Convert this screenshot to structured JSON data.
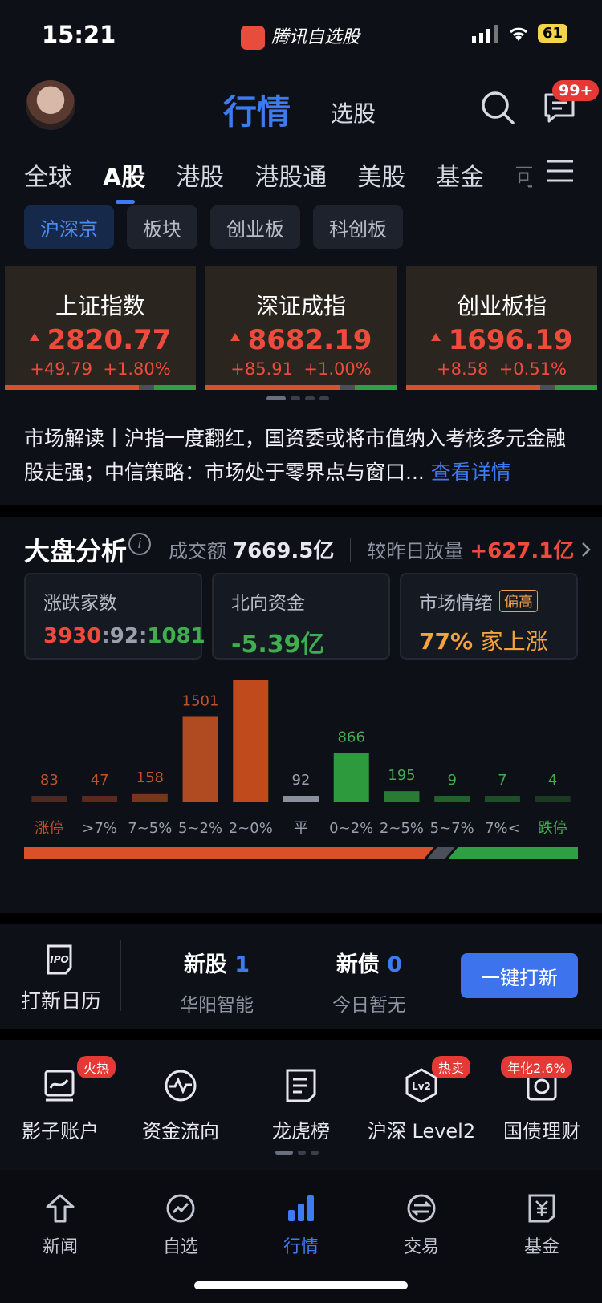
{
  "status": {
    "time": "15:21",
    "app_name": "腾讯自选股",
    "battery": "61"
  },
  "header": {
    "tab_main": "行情",
    "tab_sub": "选股",
    "msg_badge": "99+"
  },
  "market_tabs": [
    "全球",
    "A股",
    "港股",
    "港股通",
    "美股",
    "基金",
    "可"
  ],
  "chips": [
    "沪深京",
    "板块",
    "创业板",
    "科创板"
  ],
  "indices": [
    {
      "name": "上证指数",
      "price": "2820.77",
      "change": "+49.79",
      "pct": "+1.80%"
    },
    {
      "name": "深证成指",
      "price": "8682.19",
      "change": "+85.91",
      "pct": "+1.00%"
    },
    {
      "name": "创业板指",
      "price": "1696.19",
      "change": "+8.58",
      "pct": "+0.51%"
    }
  ],
  "news": {
    "text": "市场解读丨沪指一度翻红，国资委或将市值纳入考核多元金融股走强；中信策略：市场处于零界点与窗口...",
    "link": "查看详情"
  },
  "analysis": {
    "title": "大盘分析",
    "turnover_label": "成交额",
    "turnover_value": "7669.5亿",
    "vol_label": "较昨日放量",
    "vol_value": "+627.1亿",
    "boxes": {
      "updown_label": "涨跌家数",
      "up": "3930",
      "sep1": ":",
      "flat": "92",
      "sep2": ":",
      "down": "1081",
      "north_label": "北向资金",
      "north_value": "-5.39亿",
      "mood_label": "市场情绪",
      "mood_tag": "偏高",
      "mood_value": "77%",
      "mood_suffix": "家上涨"
    }
  },
  "chart_data": {
    "type": "bar",
    "categories": [
      "涨停",
      ">7%",
      "7~5%",
      "5~2%",
      "2~0%",
      "平",
      "0~2%",
      "2~5%",
      "5~7%",
      "7%<",
      "跌停"
    ],
    "values": [
      83,
      47,
      158,
      1501,
      2141,
      92,
      866,
      195,
      9,
      7,
      4
    ],
    "bar_colors": [
      "#4a2a22",
      "#5a2a1e",
      "#7a3418",
      "#b04a20",
      "#c04a1c",
      "#8a8f9c",
      "#2e9a3e",
      "#2a7a34",
      "#23602c",
      "#1f4d27",
      "#1c3a22"
    ],
    "label_colors": [
      "#c0532c",
      "#c0532c",
      "#c0532c",
      "#c0532c",
      "#c0532c",
      "#9aa0ad",
      "#3fae4e",
      "#3fae4e",
      "#3fae4e",
      "#3fae4e",
      "#3fae4e"
    ],
    "up_ratio": 0.74
  },
  "ipo": {
    "calendar_label": "打新日历",
    "new_stock_label": "新股",
    "new_stock_count": "1",
    "new_stock_name": "华阳智能",
    "new_bond_label": "新债",
    "new_bond_count": "0",
    "new_bond_name": "今日暂无",
    "button": "一键打新"
  },
  "tools": [
    {
      "label": "影子账户",
      "badge": "火热",
      "icon": "shadow-account-icon"
    },
    {
      "label": "资金流向",
      "badge": "",
      "icon": "money-flow-icon"
    },
    {
      "label": "龙虎榜",
      "badge": "",
      "icon": "dragon-tiger-list-icon"
    },
    {
      "label": "沪深 Level2",
      "badge": "热卖",
      "icon": "level2-icon"
    },
    {
      "label": "国债理财",
      "badge": "年化2.6%",
      "icon": "treasury-icon"
    }
  ],
  "bottom_nav": [
    "新闻",
    "自选",
    "行情",
    "交易",
    "基金"
  ],
  "colors": {
    "accent": "#3d7bf2",
    "up": "#ef4b3d",
    "down": "#3fae4e",
    "background": "#0d1017"
  }
}
